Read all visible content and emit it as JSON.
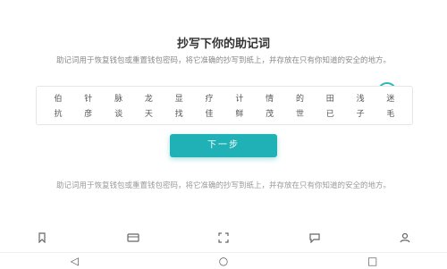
{
  "title": "抄写下你的助记词",
  "description": "助记词用于恢复钱包或重置钱包密码，将它准确的抄写到纸上，并存放在只有你知道的安全的地方。",
  "mnemonic": {
    "row1": [
      "伯",
      "针",
      "脉",
      "龙",
      "显",
      "疗",
      "计",
      "情",
      "的",
      "田",
      "浅",
      "迷"
    ],
    "row2": [
      "抗",
      "彦",
      "谈",
      "天",
      "找",
      "佳",
      "鲜",
      "茂",
      "世",
      "已",
      "子",
      "毛"
    ]
  },
  "next_button": "下一步",
  "footer_note": "助记词用于恢复钱包或重置钱包密码，将它准确的抄写到纸上，并存放在只有你知道的安全的地方。",
  "nav": {
    "back": "◁",
    "home": "○",
    "recent": "□"
  },
  "icons": {
    "toggle": "eye-icon",
    "bottom": [
      "bookmark-icon",
      "wallet-icon",
      "scan-icon",
      "chat-icon",
      "user-icon"
    ]
  },
  "colors": {
    "accent": "#1fb1b5"
  }
}
